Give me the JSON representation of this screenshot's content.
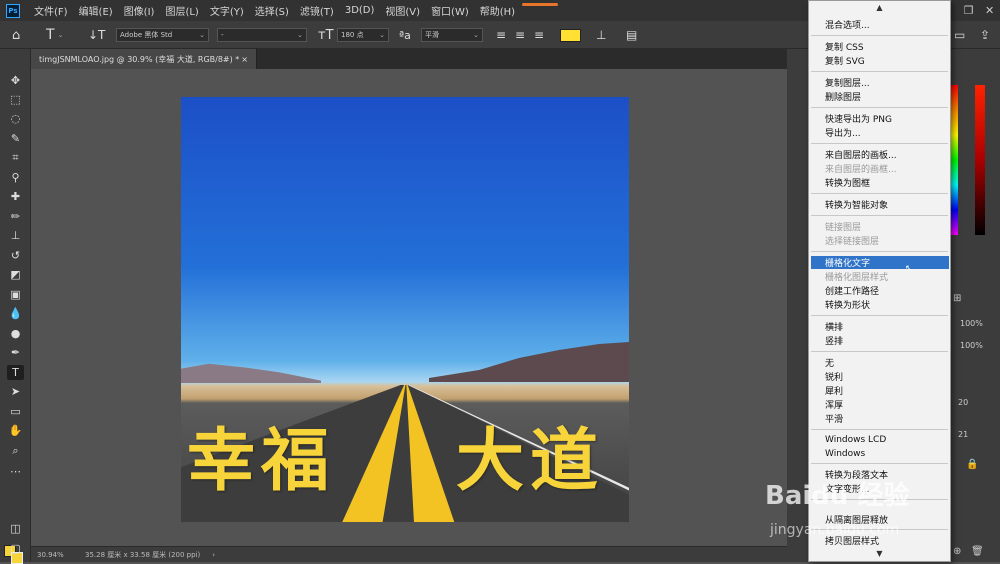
{
  "app": {
    "logo": "Ps"
  },
  "menubar": {
    "items": [
      "文件(F)",
      "编辑(E)",
      "图像(I)",
      "图层(L)",
      "文字(Y)",
      "选择(S)",
      "滤镜(T)",
      "3D(D)",
      "视图(V)",
      "窗口(W)",
      "帮助(H)"
    ]
  },
  "options": {
    "font_family": "Adobe 黑体 Std",
    "font_style": "-",
    "font_size": "180 点",
    "antialias": "平滑",
    "text_color": "#ffe033"
  },
  "document": {
    "tab_title": "timgJSNMLOAO.jpg @ 30.9% (幸福  大道, RGB/8#) *",
    "text_line1": "幸福",
    "text_line2": "大道"
  },
  "status": {
    "zoom": "30.94%",
    "size": "35.28 厘米 x 33.58 厘米 (200 ppi)"
  },
  "context_menu": {
    "items": [
      {
        "label": "混合选项...",
        "disabled": false
      },
      {
        "label": "复制 CSS",
        "disabled": false
      },
      {
        "label": "复制 SVG",
        "disabled": false
      },
      {
        "label": "复制图层...",
        "disabled": false
      },
      {
        "label": "删除图层",
        "disabled": false
      },
      {
        "label": "快速导出为 PNG",
        "disabled": false
      },
      {
        "label": "导出为...",
        "disabled": false
      },
      {
        "label": "来自图层的画板...",
        "disabled": false
      },
      {
        "label": "来自图层的画框...",
        "disabled": true
      },
      {
        "label": "转换为图框",
        "disabled": false
      },
      {
        "label": "转换为智能对象",
        "disabled": false
      },
      {
        "label": "链接图层",
        "disabled": true
      },
      {
        "label": "选择链接图层",
        "disabled": true
      },
      {
        "label": "栅格化文字",
        "highlight": true
      },
      {
        "label": "栅格化图层样式",
        "disabled": true
      },
      {
        "label": "创建工作路径",
        "disabled": false
      },
      {
        "label": "转换为形状",
        "disabled": false
      },
      {
        "label": "横排",
        "disabled": false
      },
      {
        "label": "竖排",
        "disabled": false
      },
      {
        "label": "无",
        "disabled": false
      },
      {
        "label": "锐利",
        "disabled": false
      },
      {
        "label": "犀利",
        "disabled": false
      },
      {
        "label": "浑厚",
        "disabled": false
      },
      {
        "label": "平滑",
        "disabled": false
      },
      {
        "label": "Windows LCD",
        "disabled": false
      },
      {
        "label": "Windows",
        "disabled": false
      },
      {
        "label": "转换为段落文本",
        "disabled": false
      },
      {
        "label": "文字变形...",
        "disabled": false
      },
      {
        "label": "从隔离图层释放",
        "disabled": false
      },
      {
        "label": "拷贝图层样式",
        "disabled": false
      }
    ]
  },
  "right_panel": {
    "opacity": "100%",
    "fill": "100%",
    "layer_num_1": "20",
    "layer_num_2": "21"
  },
  "watermark": {
    "text": "Baidu 经验",
    "sub": "jingyan.baidu.com"
  }
}
